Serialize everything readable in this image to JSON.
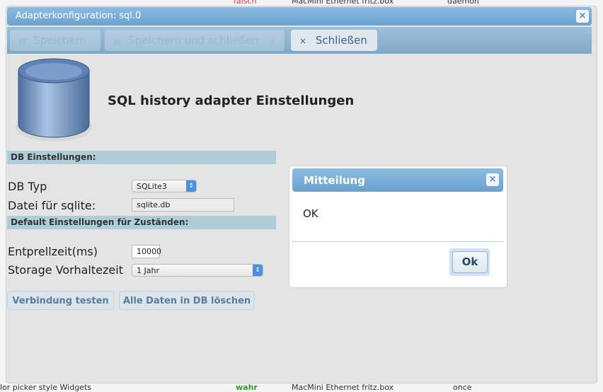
{
  "background": {
    "top_row": [
      "falsch",
      "MacMini  Ethernet fritz.box",
      "daemon"
    ],
    "bottom_row": [
      "lor picker style Widgets",
      "wahr",
      "MacMini  Ethernet fritz.box",
      "once"
    ]
  },
  "window": {
    "title": "Adapterkonfiguration: sql.0",
    "close": "×"
  },
  "toolbar": {
    "save": "Speichern",
    "save_close": "Speichern und schließen",
    "close": "Schließen",
    "close_glyph": "×",
    "save_glyph": "▤"
  },
  "header": {
    "title": "SQL history adapter Einstellungen"
  },
  "db_section": {
    "title": "DB Einstellungen:",
    "db_type_label": "DB Typ",
    "db_type_value": "SQLite3",
    "file_label": "Datei für sqlite:",
    "file_value": "sqlite.db"
  },
  "default_section": {
    "title": "Default Einstellungen für Zuständen:",
    "debounce_label": "Entprellzeit(ms)",
    "debounce_value": "10000",
    "retention_label": "Storage Vorhaltezeit",
    "retention_value": "1 Jahr"
  },
  "buttons": {
    "test": "Verbindung testen",
    "delete_all": "Alle Daten in DB löschen"
  },
  "dialog": {
    "title": "Mitteilung",
    "message": "OK",
    "ok": "Ok",
    "close": "×"
  },
  "colors": {
    "title_bar": "#6aa2d0",
    "section": "#aecdd6",
    "select_arrow": "#4a8fe0"
  }
}
